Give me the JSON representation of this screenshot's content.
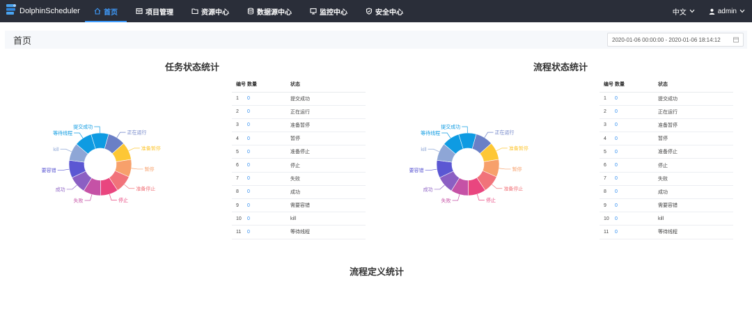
{
  "app": {
    "title": "DolphinScheduler"
  },
  "nav": [
    {
      "label": "首页",
      "icon": "home-icon",
      "active": true
    },
    {
      "label": "项目管理",
      "icon": "project-icon",
      "active": false
    },
    {
      "label": "资源中心",
      "icon": "folder-icon",
      "active": false
    },
    {
      "label": "数据源中心",
      "icon": "database-icon",
      "active": false
    },
    {
      "label": "监控中心",
      "icon": "monitor-icon",
      "active": false
    },
    {
      "label": "安全中心",
      "icon": "shield-icon",
      "active": false
    }
  ],
  "toolbar": {
    "language": "中文",
    "user": "admin"
  },
  "page": {
    "title": "首页",
    "date_range": "2020-01-06 00:00:00 - 2020-01-06 18:14:12"
  },
  "task_stats": {
    "title": "任务状态统计",
    "headers": [
      "编号",
      "数量",
      "状态"
    ],
    "rows": [
      [
        "1",
        "0",
        "提交成功"
      ],
      [
        "2",
        "0",
        "正在运行"
      ],
      [
        "3",
        "0",
        "准备暂停"
      ],
      [
        "4",
        "0",
        "暂停"
      ],
      [
        "5",
        "0",
        "准备停止"
      ],
      [
        "6",
        "0",
        "停止"
      ],
      [
        "7",
        "0",
        "失败"
      ],
      [
        "8",
        "0",
        "成功"
      ],
      [
        "9",
        "0",
        "需要容错"
      ],
      [
        "10",
        "0",
        "kill"
      ],
      [
        "11",
        "0",
        "等待线程"
      ]
    ]
  },
  "process_stats": {
    "title": "流程状态统计",
    "headers": [
      "编号",
      "数量",
      "状态"
    ],
    "rows": [
      [
        "1",
        "0",
        "提交成功"
      ],
      [
        "2",
        "0",
        "正在运行"
      ],
      [
        "3",
        "0",
        "准备暂停"
      ],
      [
        "4",
        "0",
        "暂停"
      ],
      [
        "5",
        "0",
        "准备停止"
      ],
      [
        "6",
        "0",
        "停止"
      ],
      [
        "7",
        "0",
        "失败"
      ],
      [
        "8",
        "0",
        "成功"
      ],
      [
        "9",
        "0",
        "需要容错"
      ],
      [
        "10",
        "0",
        "kill"
      ],
      [
        "11",
        "0",
        "等待线程"
      ]
    ]
  },
  "definition_stats": {
    "title": "流程定义统计"
  },
  "chart_data": [
    {
      "type": "pie",
      "donut": true,
      "categories": [
        "提交成功",
        "正在运行",
        "准备暂停",
        "暂停",
        "准备停止",
        "停止",
        "失败",
        "成功",
        "需要容错",
        "kill",
        "等待线程"
      ],
      "values": [
        0,
        0,
        0,
        0,
        0,
        0,
        0,
        0,
        0,
        0,
        0
      ],
      "colors": [
        "#0e9be2",
        "#6a7fc6",
        "#fdc735",
        "#f7a06b",
        "#f1737a",
        "#e9467f",
        "#c552a6",
        "#8b5fc3",
        "#5b57d3",
        "#8ea6d6",
        "#0e9be2"
      ]
    },
    {
      "type": "pie",
      "donut": true,
      "categories": [
        "提交成功",
        "正在运行",
        "准备暂停",
        "暂停",
        "准备停止",
        "停止",
        "失败",
        "成功",
        "需要容错",
        "kill",
        "等待线程"
      ],
      "values": [
        0,
        0,
        0,
        0,
        0,
        0,
        0,
        0,
        0,
        0,
        0
      ],
      "colors": [
        "#0e9be2",
        "#6a7fc6",
        "#fdc735",
        "#f7a06b",
        "#f1737a",
        "#e9467f",
        "#c552a6",
        "#8b5fc3",
        "#5b57d3",
        "#8ea6d6",
        "#0e9be2"
      ]
    }
  ]
}
